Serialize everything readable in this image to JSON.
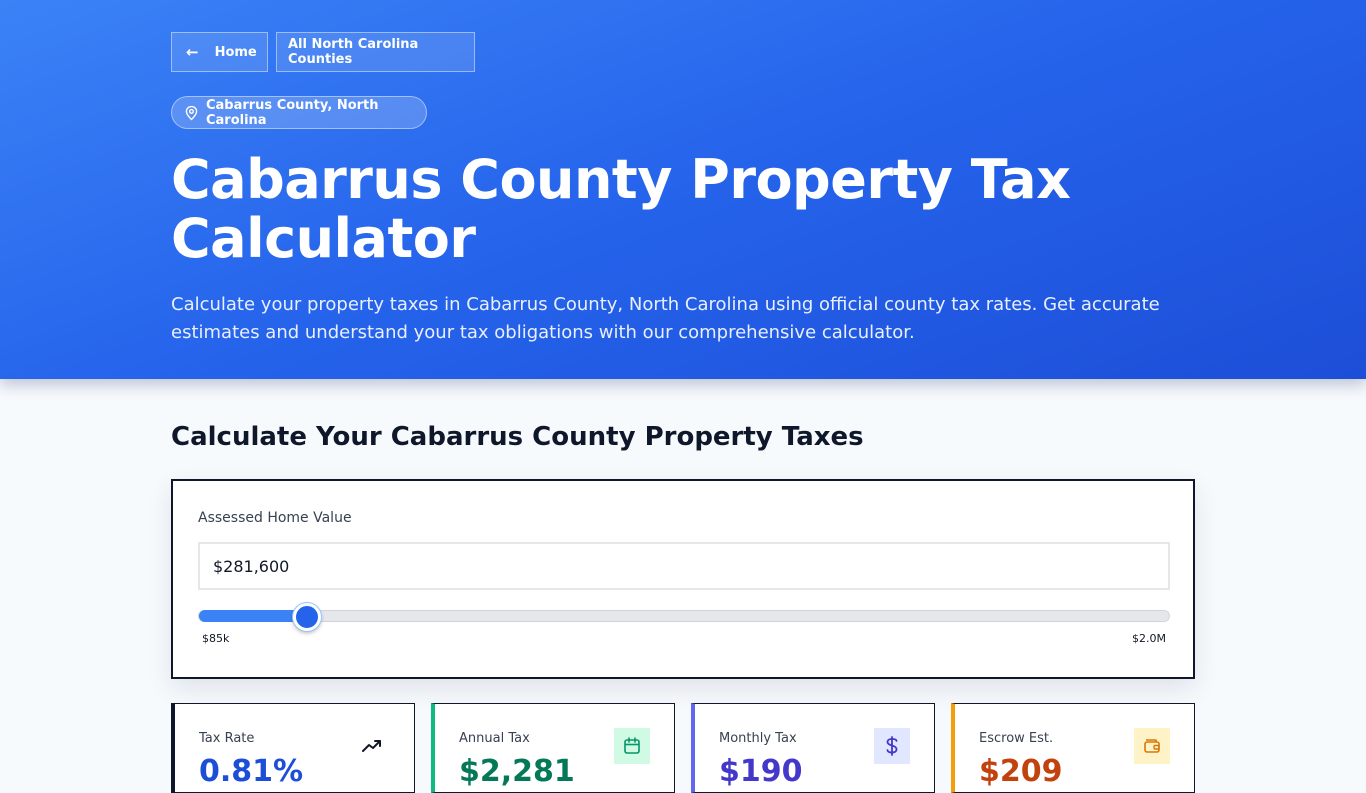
{
  "nav": {
    "home_label": "Home",
    "all_label": "All North Carolina Counties"
  },
  "hero": {
    "badge": "Cabarrus County, North Carolina",
    "title": "Cabarrus County Property Tax Calculator",
    "description": "Calculate your property taxes in Cabarrus County, North Carolina using official county tax rates. Get accurate estimates and understand your tax obligations with our comprehensive calculator."
  },
  "calculator": {
    "section_title": "Calculate Your Cabarrus County Property Taxes",
    "label": "Assessed Home Value",
    "value": "$281,600",
    "slider_min_label": "$85k",
    "slider_max_label": "$2.0M",
    "slider_fraction": 0.111
  },
  "cards": [
    {
      "label": "Tax Rate",
      "value": "0.81%",
      "accent": "#0f172a",
      "value_color": "#1d4ed8",
      "icon": "trending-up-icon"
    },
    {
      "label": "Annual Tax",
      "value": "$2,281",
      "accent": "#10b981",
      "value_color": "#047857",
      "icon": "calendar-icon"
    },
    {
      "label": "Monthly Tax",
      "value": "$190",
      "accent": "#6366f1",
      "value_color": "#4338ca",
      "icon": "dollar-icon"
    },
    {
      "label": "Escrow Est.",
      "value": "$209",
      "accent": "#f59e0b",
      "value_color": "#c2410c",
      "icon": "wallet-icon"
    }
  ],
  "colors": {
    "hero_start": "#3b82f6",
    "hero_end": "#1d4ed8",
    "accent": "#2563eb"
  }
}
